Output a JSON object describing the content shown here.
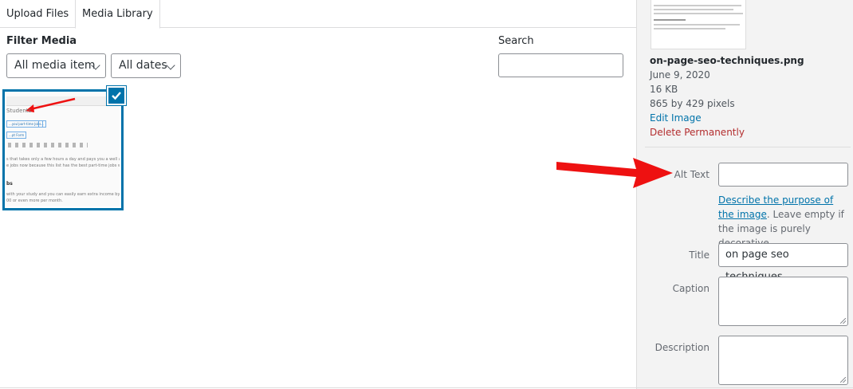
{
  "tabs": {
    "upload": "Upload Files",
    "library": "Media Library"
  },
  "filter": {
    "title": "Filter Media",
    "type_selected": "All media item",
    "date_selected": "All dates"
  },
  "search": {
    "label": "Search",
    "value": "",
    "placeholder": ""
  },
  "thumbnail": {
    "heading": "Students",
    "button_a": "...you'part-time Jobs",
    "button_b": "...",
    "button_c": "...pt Form",
    "lines": [
      "s that takes only a few hours a day and pays you a well amou",
      "e jobs now because this list has the best part-time jobs witho",
      "with your study and you can easily earn extra income by wor",
      "00 or even more per month."
    ],
    "bold": "bs"
  },
  "details": {
    "filename": "on-page-seo-techniques.png",
    "date": "June 9, 2020",
    "size": "16 KB",
    "dimensions": "865 by 429 pixels",
    "edit_link": "Edit Image",
    "delete_link": "Delete Permanently"
  },
  "fields": {
    "alt_label": "Alt Text",
    "alt_value": "",
    "help_link": "Describe the purpose of the image",
    "help_text": ". Leave empty if the image is purely decorative.",
    "title_label": "Title",
    "title_value": "on page seo techniques",
    "caption_label": "Caption",
    "caption_value": "",
    "description_label": "Description",
    "description_value": ""
  },
  "colors": {
    "accent": "#0073aa",
    "danger": "#b32d2e",
    "annotation_arrow": "#ee1111"
  }
}
